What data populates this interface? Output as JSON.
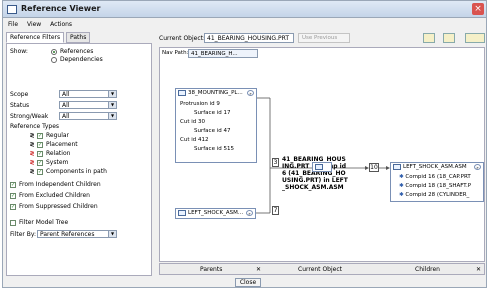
{
  "window": {
    "title": "Reference Viewer"
  },
  "menu": [
    "File",
    "View",
    "Actions"
  ],
  "tabs": [
    "Reference Filters",
    "Paths"
  ],
  "filters": {
    "show_label": "Show:",
    "show_options": [
      "References",
      "Dependencies"
    ],
    "scope_label": "Scope",
    "scope_value": "All",
    "status_label": "Status",
    "status_value": "All",
    "strong_weak_label": "Strong/Weak",
    "strong_weak_value": "All",
    "ref_types_label": "Reference Types",
    "ref_types": [
      "Regular",
      "Placement",
      "Relation",
      "System",
      "Components in path"
    ],
    "check_options": [
      "From Independent Children",
      "From Excluded Children",
      "From Suppressed Children"
    ],
    "filter_model_tree": "Filter Model Tree",
    "filter_by_label": "Filter By:",
    "filter_by_value": "Parent References"
  },
  "toolbar": {
    "current_object_label": "Current Object:",
    "current_object_value": "41_BEARING_HOUSING.PRT",
    "use_previous": "Use Previous"
  },
  "canvas": {
    "nav_label": "Nav Path:",
    "nav_item": "41_BEARING_H...",
    "node1_title": "38_MOUNTING_PL...",
    "node1_items": [
      "Protrusion id 9",
      "Surface id 17",
      "Cut id 30",
      "Surface id 47",
      "Cut id 412",
      "Surface id 515"
    ],
    "node2_title": "LEFT_SHOCK_ASM...",
    "center_badge": "3",
    "center_lines": [
      "41_BEARING_HOUS",
      "ING.PRT + Comp id",
      "6 (41_BEARING_HO",
      "USING.PRT) in LEFT",
      "_SHOCK_ASM.ASM"
    ],
    "link_num_left": "7",
    "link_num_right": "10",
    "node3_title": "LEFT_SHOCK_ASM.ASM",
    "node3_items": [
      "Compid 16 (18_CAP.PRT",
      "Compid 18 (18_SHAFT.P",
      "Compid 28 (CYLINDER_"
    ]
  },
  "bottom": {
    "parents": "Parents",
    "current": "Current Object",
    "children": "Children"
  },
  "close_label": "Close"
}
